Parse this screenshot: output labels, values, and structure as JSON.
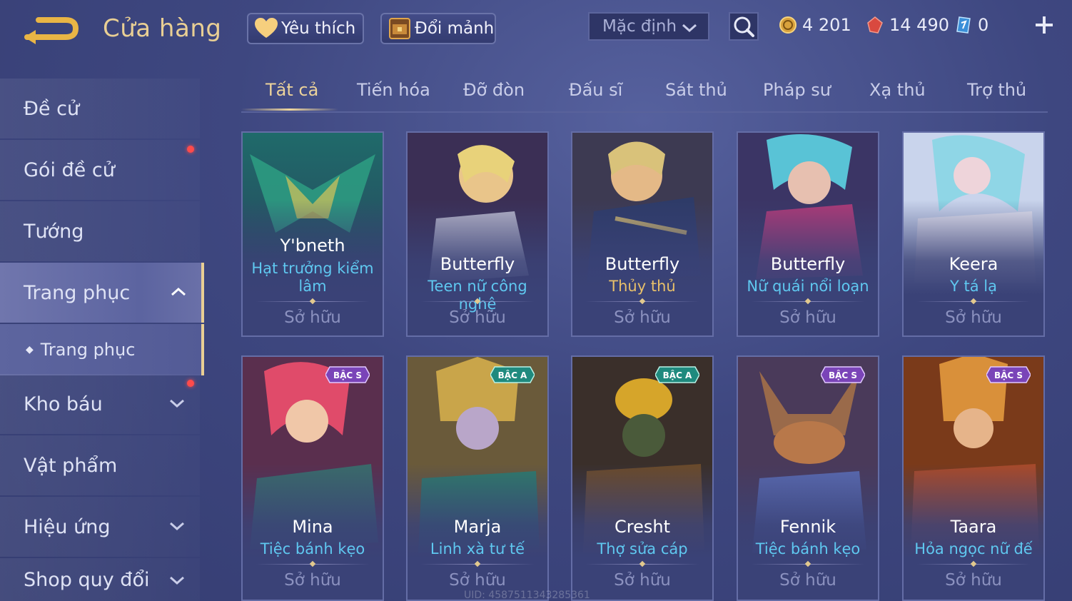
{
  "header": {
    "title": "Cửa hàng",
    "favorites_label": "Yêu thích",
    "shard_exchange_label": "Đổi mảnh",
    "sort_value": "Mặc định"
  },
  "currencies": {
    "gold": "4 201",
    "ruby": "14 490",
    "voucher": "0"
  },
  "sidebar": {
    "items": [
      {
        "label": "Đề cử"
      },
      {
        "label": "Gói đề cử"
      },
      {
        "label": "Tướng"
      },
      {
        "label": "Trang phục"
      },
      {
        "label": "Trang phục"
      },
      {
        "label": "Kho báu"
      },
      {
        "label": "Vật phẩm"
      },
      {
        "label": "Hiệu ứng"
      },
      {
        "label": "Shop quy đổi"
      }
    ]
  },
  "tabs": [
    {
      "label": "Tất cả"
    },
    {
      "label": "Tiến hóa"
    },
    {
      "label": "Đỡ đòn"
    },
    {
      "label": "Đấu sĩ"
    },
    {
      "label": "Sát thủ"
    },
    {
      "label": "Pháp sư"
    },
    {
      "label": "Xạ thủ"
    },
    {
      "label": "Trợ thủ"
    }
  ],
  "cards": [
    {
      "hero": "Y'bneth",
      "skin_line1": "Hạt trưởng kiểm",
      "skin_line2": "lâm",
      "status": "Sở hữu",
      "badge": ""
    },
    {
      "hero": "Butterfly",
      "skin_line1": "Teen nữ công nghệ",
      "skin_line2": "",
      "status": "Sở hữu",
      "badge": ""
    },
    {
      "hero": "Butterfly",
      "skin_line1": "Thủy thủ",
      "skin_line2": "",
      "status": "Sở hữu",
      "badge": ""
    },
    {
      "hero": "Butterfly",
      "skin_line1": "Nữ quái nổi loạn",
      "skin_line2": "",
      "status": "Sở hữu",
      "badge": ""
    },
    {
      "hero": "Keera",
      "skin_line1": "Y tá lạ",
      "skin_line2": "",
      "status": "Sở hữu",
      "badge": ""
    },
    {
      "hero": "Mina",
      "skin_line1": "Tiệc bánh kẹo",
      "skin_line2": "",
      "status": "Sở hữu",
      "badge": "BẬC S"
    },
    {
      "hero": "Marja",
      "skin_line1": "Linh xà tư tế",
      "skin_line2": "",
      "status": "Sở hữu",
      "badge": "BẬC A"
    },
    {
      "hero": "Cresht",
      "skin_line1": "Thợ sửa cáp",
      "skin_line2": "",
      "status": "Sở hữu",
      "badge": "BẬC A"
    },
    {
      "hero": "Fennik",
      "skin_line1": "Tiệc bánh kẹo",
      "skin_line2": "",
      "status": "Sở hữu",
      "badge": "BẬC S"
    },
    {
      "hero": "Taara",
      "skin_line1": "Hỏa ngọc nữ đế",
      "skin_line2": "",
      "status": "Sở hữu",
      "badge": "BẬC S"
    }
  ],
  "footer": {
    "uid": "UID: 4587511343285361"
  },
  "colors": {
    "accent_gold": "#e9cf94",
    "skin_name": "#5fc8f0",
    "notification": "#ff4b4b"
  }
}
